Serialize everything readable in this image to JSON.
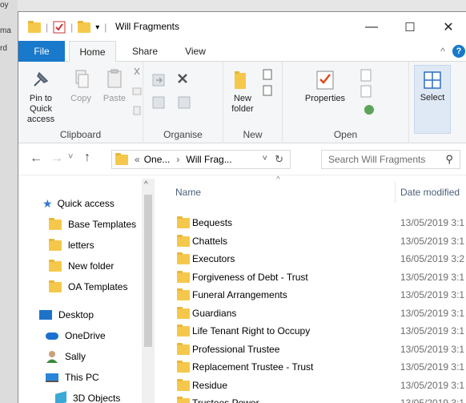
{
  "window": {
    "title": "Will Fragments",
    "minimize_glyph": "—",
    "maximize_glyph": "☐",
    "close_glyph": "✕",
    "qat_dropdown": "▾",
    "qat_separator": "|"
  },
  "background_fragments": [
    "oy",
    "ma",
    "rd"
  ],
  "tabs": {
    "file": "File",
    "home": "Home",
    "share": "Share",
    "view": "View",
    "collapse": "^",
    "help": "?"
  },
  "ribbon": {
    "clipboard": {
      "pin": "Pin to Quick access",
      "copy": "Copy",
      "paste": "Paste",
      "label": "Clipboard"
    },
    "organise": {
      "label": "Organise"
    },
    "new": {
      "new_folder": "New folder",
      "label": "New"
    },
    "open": {
      "properties": "Properties",
      "label": "Open"
    },
    "select": {
      "select": "Select"
    }
  },
  "address": {
    "back": "←",
    "forward": "→",
    "recent": "˅",
    "up": "↑",
    "overflow": "«",
    "crumbs": [
      "One...",
      "Will Frag..."
    ],
    "sep": "›",
    "dropdown": "˅",
    "refresh": "↻",
    "search_placeholder": "Search Will Fragments",
    "search_glyph": "⚲"
  },
  "nav": {
    "quick_access": "Quick access",
    "items": [
      "Base Templates",
      "letters",
      "New folder",
      "OA Templates"
    ],
    "desktop": "Desktop",
    "onedrive": "OneDrive",
    "user": "Sally",
    "thispc": "This PC",
    "objects3d": "3D Objects",
    "scroll_up": "^"
  },
  "list": {
    "col_name": "Name",
    "col_date": "Date modified",
    "sort_indicator": "^",
    "files": [
      {
        "name": "Bequests",
        "date": "13/05/2019 3:1"
      },
      {
        "name": "Chattels",
        "date": "13/05/2019 3:1"
      },
      {
        "name": "Executors",
        "date": "16/05/2019 3:2"
      },
      {
        "name": "Forgiveness of Debt - Trust",
        "date": "13/05/2019 3:1"
      },
      {
        "name": "Funeral Arrangements",
        "date": "13/05/2019 3:1"
      },
      {
        "name": "Guardians",
        "date": "13/05/2019 3:1"
      },
      {
        "name": "Life Tenant Right to Occupy",
        "date": "13/05/2019 3:1"
      },
      {
        "name": "Professional Trustee",
        "date": "13/05/2019 3:1"
      },
      {
        "name": "Replacement Trustee - Trust",
        "date": "13/05/2019 3:1"
      },
      {
        "name": "Residue",
        "date": "13/05/2019 3:1"
      },
      {
        "name": "Trustees Power",
        "date": "13/05/2019 3:1"
      }
    ]
  },
  "colors": {
    "accent": "#1979ca",
    "folder": "#f5c84c"
  }
}
